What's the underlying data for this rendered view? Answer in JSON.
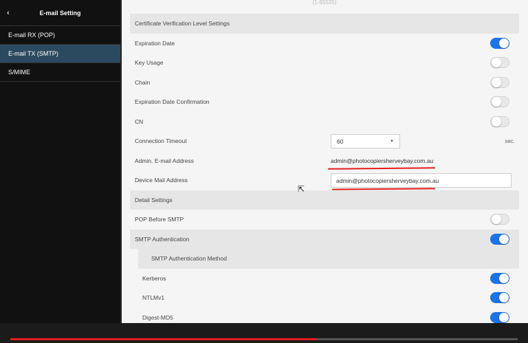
{
  "sidebar": {
    "back_icon": "chevron-left-icon",
    "title": "E-mail Setting",
    "items": [
      {
        "label": "E-mail RX (POP)",
        "active": false
      },
      {
        "label": "E-mail TX (SMTP)",
        "active": true
      },
      {
        "label": "S/MIME",
        "active": false
      }
    ]
  },
  "main": {
    "top_cut_text": "(1-65535)",
    "cert_section": "Certificate Verification Level Settings",
    "expiration_date": {
      "label": "Expiration Date",
      "on": true
    },
    "key_usage": {
      "label": "Key Usage",
      "on": false
    },
    "chain": {
      "label": "Chain",
      "on": false
    },
    "expiration_confirm": {
      "label": "Expiration Date Confirmation",
      "on": false
    },
    "cn": {
      "label": "CN",
      "on": false
    },
    "connection_timeout": {
      "label": "Connection Timeout",
      "value": "60",
      "unit": "sec."
    },
    "admin_email": {
      "label": "Admin. E-mail Address",
      "value": "admin@photocopiersherveybay.com.au"
    },
    "device_mail": {
      "label": "Device Mail Address",
      "value": "admin@photocopiersherveybay.com.au"
    },
    "detail_section": "Detail Settings",
    "pop_before_smtp": {
      "label": "POP Before SMTP",
      "on": false
    },
    "smtp_auth": {
      "label": "SMTP Authentication",
      "on": true
    },
    "smtp_auth_method": "SMTP Authentication Method",
    "kerberos": {
      "label": "Kerberos",
      "on": true
    },
    "ntlmv1": {
      "label": "NTLMv1",
      "on": true
    },
    "digest_md5": {
      "label": "Digest-MD5",
      "on": true
    }
  },
  "video": {
    "progress_fraction": 0.605
  },
  "colors": {
    "accent": "#1a73e8",
    "active_nav": "#2c4a5f",
    "annotation": "#e41b1b"
  }
}
